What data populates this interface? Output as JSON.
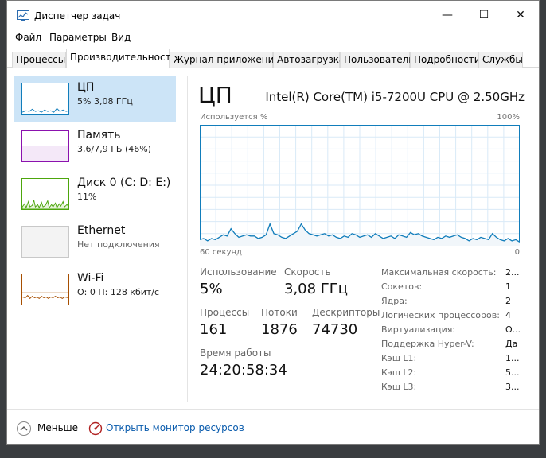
{
  "window": {
    "title": "Диспетчер задач"
  },
  "controls": {
    "minimize": "—",
    "maximize": "☐",
    "close": "✕"
  },
  "menu": [
    "Файл",
    "Параметры",
    "Вид"
  ],
  "tabs": [
    "Процессы",
    "Производительность",
    "Журнал приложений",
    "Автозагрузка",
    "Пользователи",
    "Подробности",
    "Службы"
  ],
  "active_tab": "Производительность",
  "sidebar": {
    "items": [
      {
        "name": "ЦП",
        "detail": "5% 3,08 ГГц",
        "color": "#117dbb"
      },
      {
        "name": "Память",
        "detail": "3,6/7,9 ГБ (46%)",
        "color": "#8b12ae"
      },
      {
        "name": "Диск 0 (C: D: E:)",
        "detail": "11%",
        "color": "#4da60c"
      },
      {
        "name": "Ethernet",
        "detail": "Нет подключения",
        "color": "#a0a0a0"
      },
      {
        "name": "Wi-Fi",
        "detail": "О: 0 П: 128 кбит/с",
        "color": "#a74f01"
      }
    ]
  },
  "cpu": {
    "title": "ЦП",
    "model": "Intel(R) Core(TM) i5-7200U CPU @ 2.50GHz",
    "graph": {
      "y_label": "Используется %",
      "y_max_label": "100%",
      "x_left_label": "60 секунд",
      "x_right_label": "0",
      "usage_values": [
        5,
        6,
        4,
        6,
        5,
        7,
        9,
        8,
        14,
        10,
        7,
        8,
        9,
        8,
        8,
        6,
        7,
        9,
        18,
        10,
        9,
        7,
        6,
        8,
        10,
        12,
        18,
        13,
        10,
        9,
        8,
        9,
        10,
        8,
        9,
        7,
        6,
        8,
        7,
        10,
        9,
        7,
        8,
        9,
        7,
        10,
        8,
        6,
        7,
        8,
        6,
        9,
        8,
        7,
        11,
        9,
        10,
        8,
        7,
        6,
        5,
        7,
        6,
        8,
        7,
        8,
        9,
        7,
        6,
        4,
        6,
        5,
        7,
        6,
        5,
        10,
        7,
        5,
        4,
        6,
        4,
        5,
        3
      ]
    },
    "stats": {
      "usage_label": "Использование",
      "usage": "5%",
      "speed_label": "Скорость",
      "speed": "3,08 ГГц",
      "processes_label": "Процессы",
      "processes": "161",
      "threads_label": "Потоки",
      "threads": "1876",
      "handles_label": "Дескрипторы",
      "handles": "74730",
      "uptime_label": "Время работы",
      "uptime": "24:20:58:34"
    },
    "specs": [
      {
        "label": "Максимальная скорость:",
        "value": "2..."
      },
      {
        "label": "Сокетов:",
        "value": "1"
      },
      {
        "label": "Ядра:",
        "value": "2"
      },
      {
        "label": "Логических процессоров:",
        "value": "4"
      },
      {
        "label": "Виртуализация:",
        "value": "О..."
      },
      {
        "label": "Поддержка Hyper-V:",
        "value": "Да"
      },
      {
        "label": "Кэш L1:",
        "value": "1..."
      },
      {
        "label": "Кэш L2:",
        "value": "5..."
      },
      {
        "label": "Кэш L3:",
        "value": "3..."
      }
    ]
  },
  "footer": {
    "less": "Меньше",
    "monitor_link": "Открыть монитор ресурсов"
  },
  "colors": {
    "accent": "#117dbb",
    "selected": "#cce4f7",
    "link": "#0b5cad"
  }
}
